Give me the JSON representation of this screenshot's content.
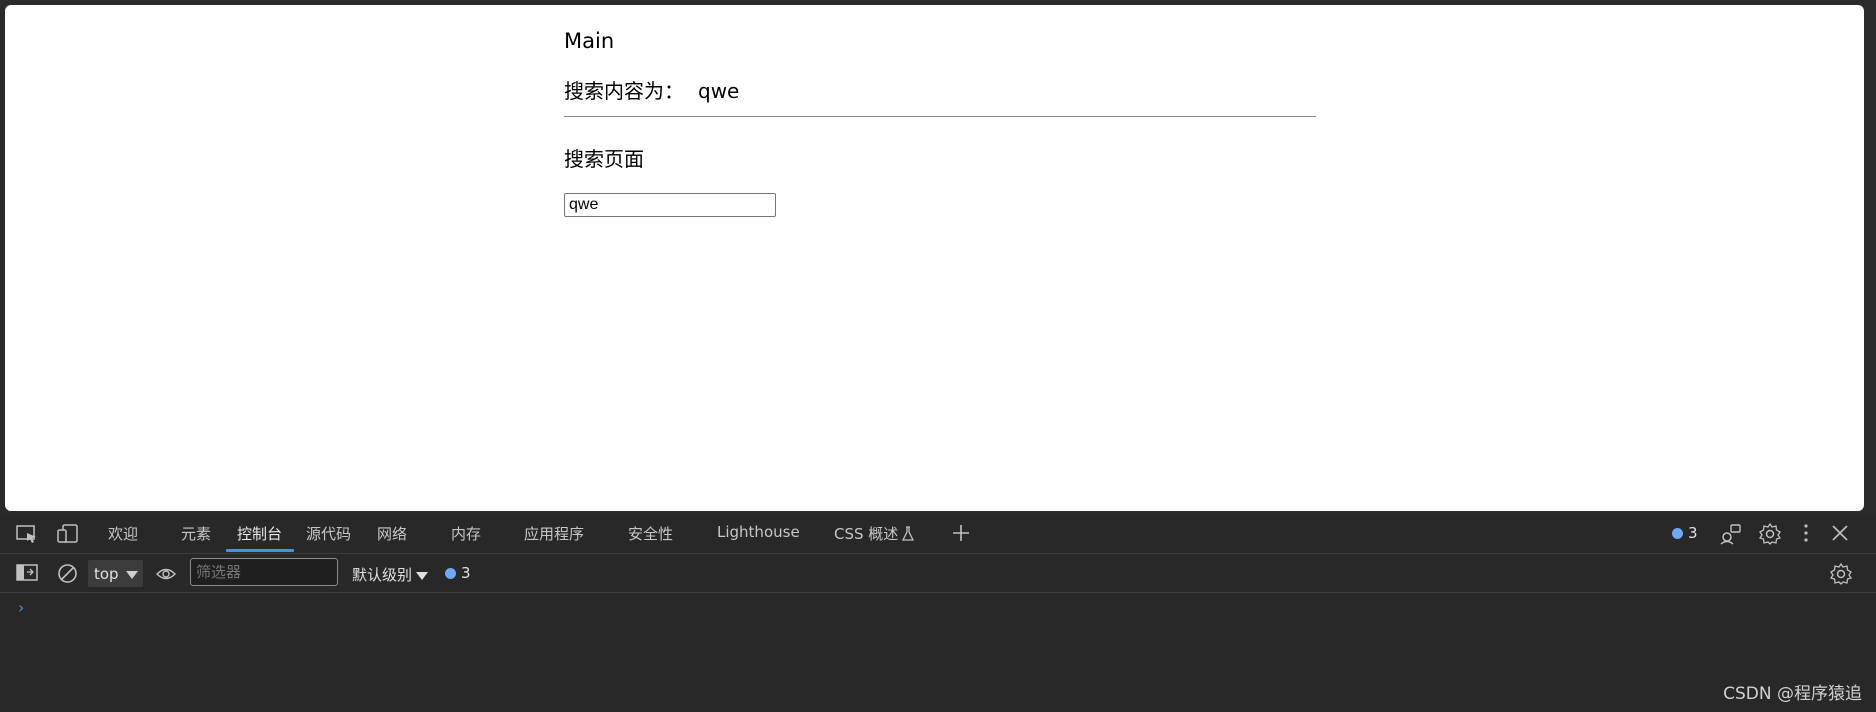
{
  "page": {
    "main_title": "Main",
    "result_label": "搜索内容为：",
    "result_value": "qwe",
    "search_title": "搜索页面",
    "search_input_value": "qwe"
  },
  "devtools": {
    "tabs": [
      "欢迎",
      "元素",
      "控制台",
      "源代码",
      "网络",
      "内存",
      "应用程序",
      "安全性",
      "Lighthouse",
      "CSS 概述"
    ],
    "active_tab": "控制台",
    "issues_count": "3",
    "toolbar": {
      "context": "top",
      "filter_placeholder": "筛选器",
      "level": "默认级别",
      "message_count": "3"
    },
    "prompt_symbol": "›",
    "accent_color": "#4a90d9"
  },
  "watermark": "CSDN @程序猿追"
}
